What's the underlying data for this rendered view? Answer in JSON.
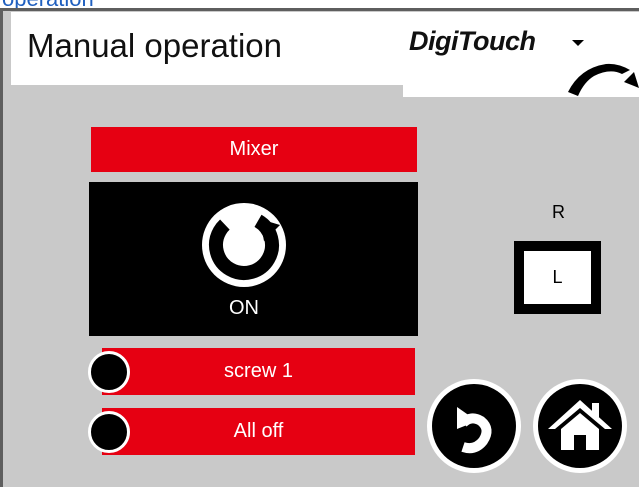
{
  "header": {
    "partial_title_above": "operation",
    "title": "Manual operation",
    "logo_text": "DigiTouch"
  },
  "mixer": {
    "label": "Mixer",
    "state_text": "ON",
    "icon": "rotate-icon"
  },
  "switch": {
    "top_label": "R",
    "box_label": "L"
  },
  "buttons": {
    "screw": "screw 1",
    "all_off": "All off",
    "back_icon": "back-icon",
    "home_icon": "home-icon"
  },
  "colors": {
    "red": "#e60012",
    "panel_grey": "#c9c9c9",
    "black": "#000000",
    "white": "#ffffff",
    "title_blue": "#1f5fbf"
  }
}
